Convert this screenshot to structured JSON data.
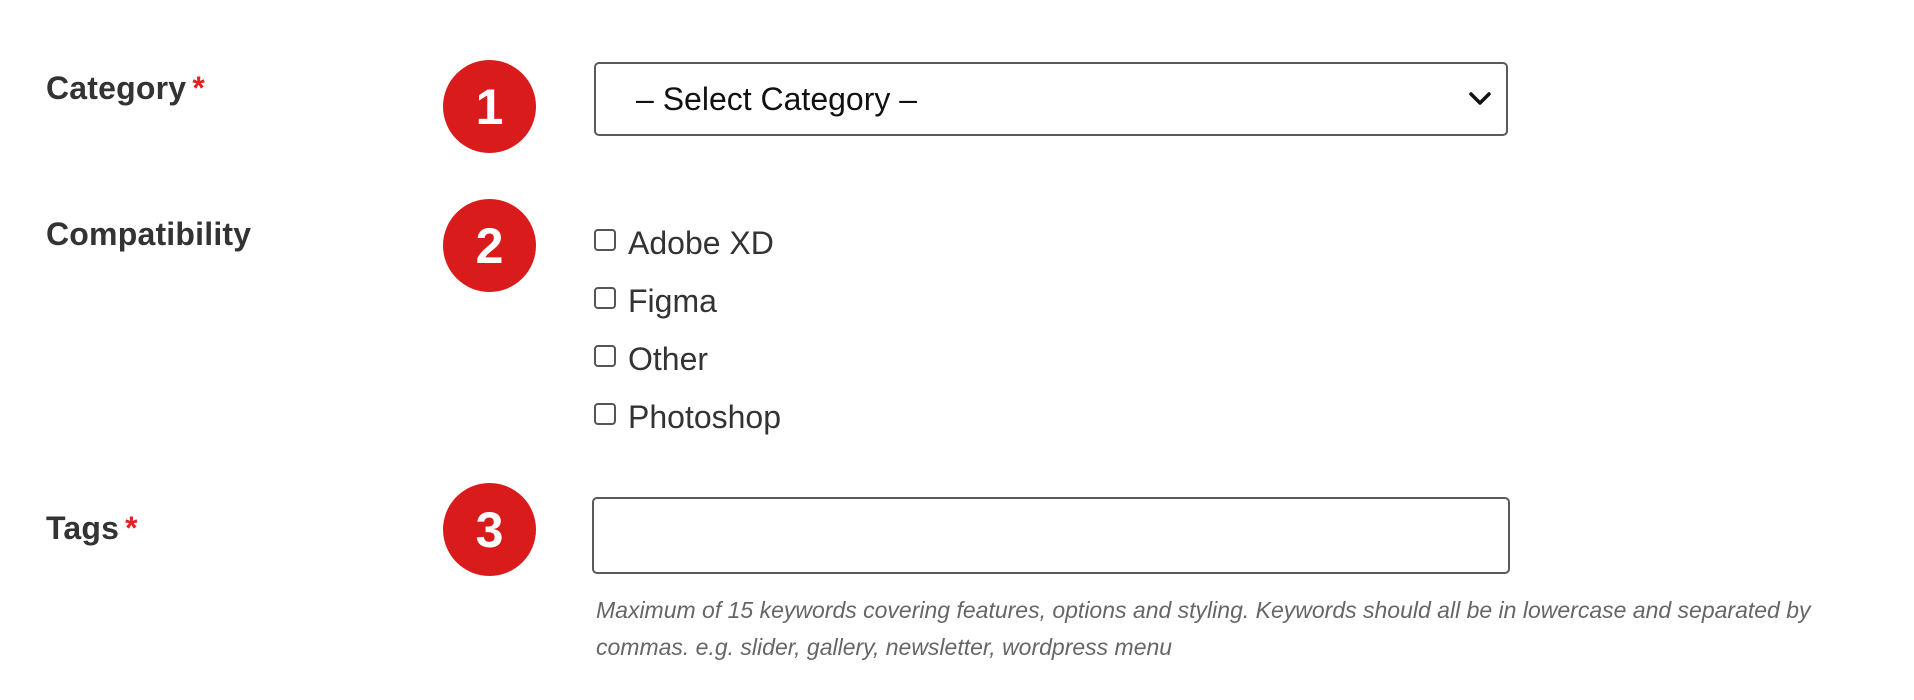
{
  "category": {
    "label": "Category",
    "required_mark": "*",
    "step_number": "1",
    "select": {
      "selected_value": "– Select Category –"
    }
  },
  "compatibility": {
    "label": "Compatibility",
    "step_number": "2",
    "options": [
      {
        "label": "Adobe XD",
        "checked": false
      },
      {
        "label": "Figma",
        "checked": false
      },
      {
        "label": "Other",
        "checked": false
      },
      {
        "label": "Photoshop",
        "checked": false
      }
    ]
  },
  "tags": {
    "label": "Tags",
    "required_mark": "*",
    "step_number": "3",
    "value": "",
    "help_text": "Maximum of 15 keywords covering features, options and styling. Keywords should all be in lowercase and separated by commas. e.g. slider, gallery, newsletter, wordpress menu"
  },
  "colors": {
    "badge": "#d91b1b",
    "required": "#e02424",
    "label_text": "#333333",
    "help_text": "#666666",
    "border": "#5a5a5a"
  },
  "icons": {
    "select_chevron": "chevron-down-icon",
    "step_badge": "numbered-circle"
  }
}
